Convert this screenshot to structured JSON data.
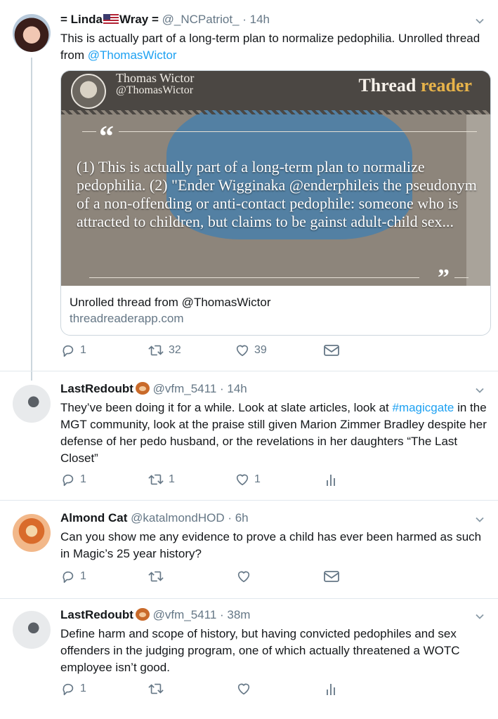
{
  "tweets": [
    {
      "name_pre": "= Linda",
      "name_post": "Wray =",
      "handle": "@_NCPatriot_",
      "time": "· 14h",
      "text": "This is actually part of a long-term plan to normalize pedophilia.  Unrolled thread from ",
      "mention": "@ThomasWictor",
      "card": {
        "author_name": "Thomas Wictor",
        "author_handle": "@ThomasWictor",
        "brand_part1": "Thread",
        "brand_part2": "reader",
        "quote_open": "“",
        "quote_close": "”",
        "quote": "(1) This is actually part of a long-term plan to normalize pedophilia. (2) \"Ender Wigginaka @enderphileis the pseudonym of a non-offending or anti-contact pedophile: someone who is attracted to children, but claims to be gainst adult-child sex...",
        "title": "Unrolled thread from @ThomasWictor",
        "domain": "threadreaderapp.com"
      },
      "actions": {
        "replies": "1",
        "retweets": "32",
        "likes": "39"
      }
    },
    {
      "name": "LastRedoubt",
      "handle": "@vfm_5411",
      "time": "· 14h",
      "text_pre": "They’ve been doing it for a while. Look at slate articles, look at ",
      "hashtag": "#magicgate",
      "text_post": " in the MGT community, look at the praise still given Marion Zimmer Bradley despite her defense of her pedo husband, or the revelations in her daughters “The Last Closet”",
      "actions": {
        "replies": "1",
        "retweets": "1",
        "likes": "1"
      }
    },
    {
      "name": "Almond Cat",
      "handle": "@katalmondHOD",
      "time": "· 6h",
      "text": "Can you show me any evidence to prove a child has ever been harmed as such in Magic’s 25 year history?",
      "actions": {
        "replies": "1",
        "retweets": "",
        "likes": ""
      }
    },
    {
      "name": "LastRedoubt",
      "handle": "@vfm_5411",
      "time": "· 38m",
      "text": "Define harm and scope of history, but having convicted pedophiles and sex offenders in the judging program, one of which actually threatened a WOTC employee isn’t good.",
      "actions": {
        "replies": "1",
        "retweets": "",
        "likes": ""
      }
    }
  ],
  "icons": {
    "reply": "reply-icon",
    "retweet": "retweet-icon",
    "like": "heart-icon",
    "dm": "mail-icon",
    "analytics": "analytics-icon",
    "caret": "chevron-down-icon"
  },
  "colors": {
    "link": "#1da1f2",
    "muted": "#657786",
    "thread_line": "#ccd6dd"
  }
}
